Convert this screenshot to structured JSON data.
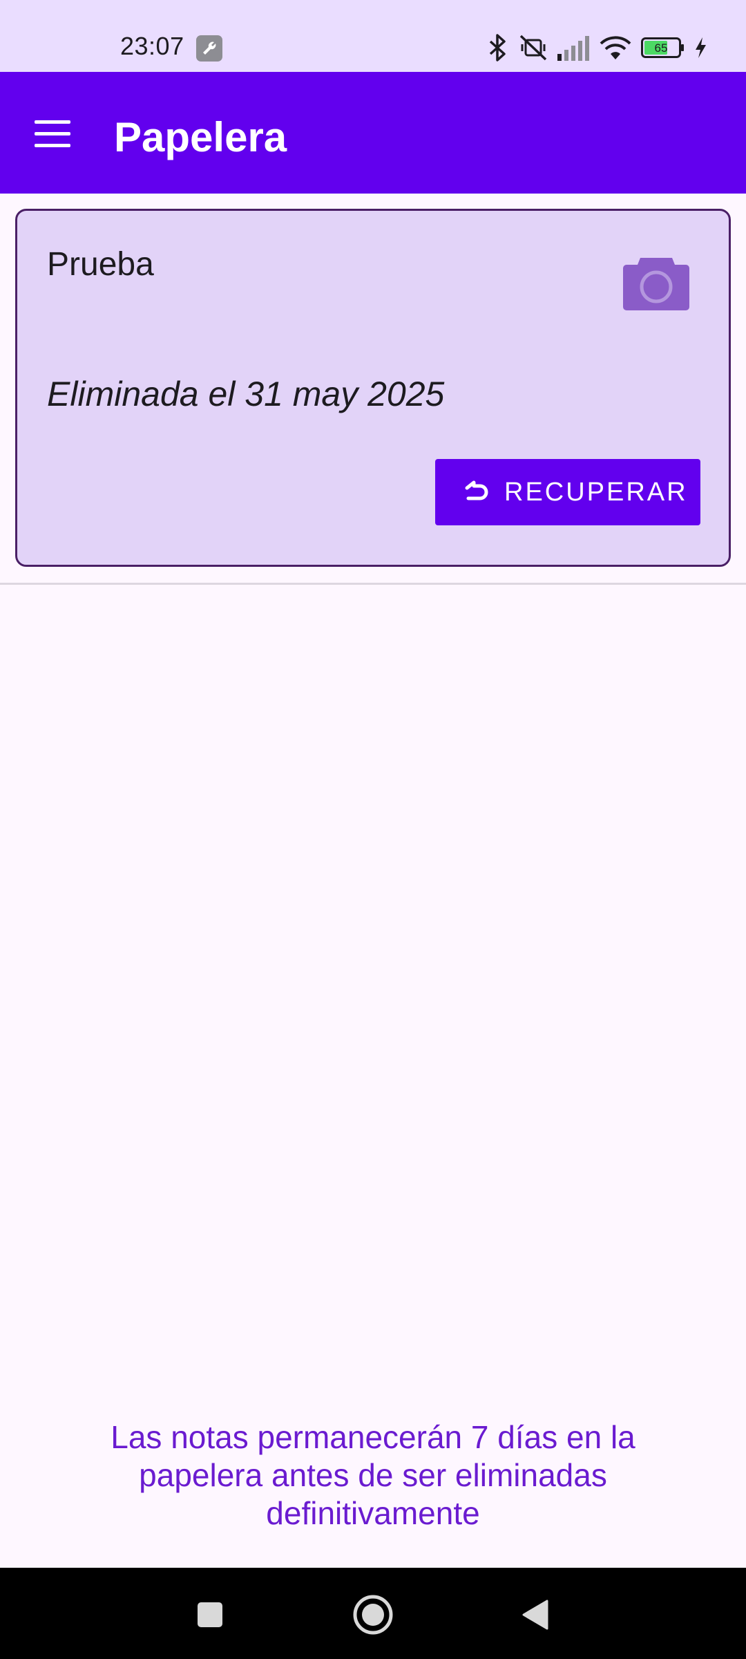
{
  "status_bar": {
    "time": "23:07",
    "battery_level": "65",
    "icons": [
      "wrench-icon",
      "bluetooth-icon",
      "mute-icon",
      "signal-icon",
      "wifi-icon",
      "battery-icon",
      "charging-icon"
    ]
  },
  "app_bar": {
    "title": "Papelera",
    "menu_icon": "menu-icon"
  },
  "notes": [
    {
      "title": "Prueba",
      "deleted_label": "Eliminada el 31 may 2025",
      "recover_label": "RECUPERAR",
      "thumbnail_icon": "camera-icon"
    }
  ],
  "footer": {
    "retention_message": "Las notas permanecerán 7 días en la papelera antes de ser eliminadas definitivamente"
  },
  "colors": {
    "app_bar": "#6200EE",
    "status_bar": "#EADDFF",
    "card_background": "#E2D3F8",
    "card_border": "#4A1F66",
    "background": "#FEF7FF",
    "accent_text": "#6A1BD0"
  }
}
